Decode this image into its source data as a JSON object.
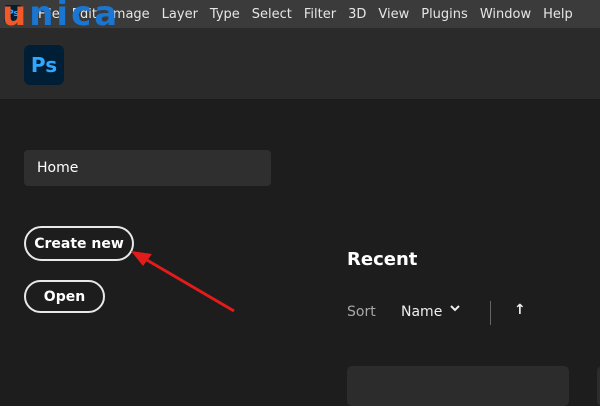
{
  "menubar": {
    "items": [
      "File",
      "Edit",
      "Image",
      "Layer",
      "Type",
      "Select",
      "Filter",
      "3D",
      "View",
      "Plugins",
      "Window",
      "Help"
    ]
  },
  "watermark": {
    "first": "u",
    "rest": "nica"
  },
  "app": {
    "logo": "Ps"
  },
  "sidebar": {
    "home": "Home",
    "create_new": "Create new",
    "open": "Open"
  },
  "recent": {
    "title": "Recent",
    "sort_label": "Sort",
    "sort_value": "Name",
    "chevron": "⌄",
    "sort_dir": "↑"
  },
  "colors": {
    "annotation": "#e21b1b",
    "accent": "#31a8ff"
  }
}
